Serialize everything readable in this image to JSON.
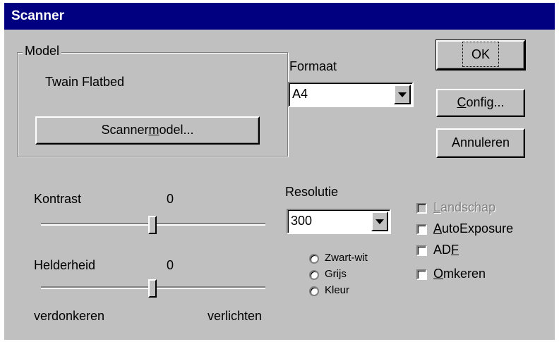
{
  "window": {
    "title": "Scanner"
  },
  "model_group": {
    "legend": "Model",
    "model_name": "Twain Flatbed",
    "button": {
      "pre": "Scanner",
      "accel": "m",
      "post": "odel..."
    }
  },
  "format": {
    "label": "Formaat",
    "value": "A4"
  },
  "buttons": {
    "ok": "OK",
    "config": {
      "accel": "C",
      "post": "onfig..."
    },
    "cancel": "Annuleren"
  },
  "contrast": {
    "label": "Kontrast",
    "value": "0",
    "level_fraction": 0.5
  },
  "brightness": {
    "label": "Helderheid",
    "value": "0",
    "level_fraction": 0.5
  },
  "scale": {
    "left": "verdonkeren",
    "right": "verlichten"
  },
  "resolution": {
    "label": "Resolutie",
    "value": "300"
  },
  "color_mode": {
    "options": [
      "Zwart-wit",
      "Grijs",
      "Kleur"
    ],
    "selected": null
  },
  "options": {
    "landscape": {
      "accel": "L",
      "post": "andschap",
      "enabled": false,
      "checked": false
    },
    "autoexposure": {
      "accel": "A",
      "post": "utoExposure",
      "enabled": true,
      "checked": false
    },
    "adf": {
      "pre": "AD",
      "accel": "F",
      "enabled": true,
      "checked": false
    },
    "invert": {
      "accel": "O",
      "post": "mkeren",
      "enabled": true,
      "checked": false
    }
  }
}
